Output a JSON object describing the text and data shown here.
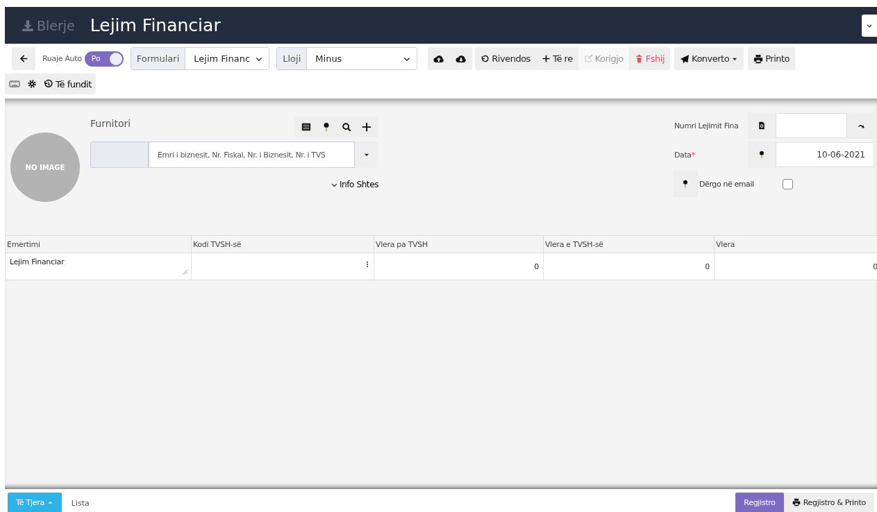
{
  "header": {
    "section": "Blerje",
    "title": "Lejim Financiar"
  },
  "toolbar": {
    "autosave": {
      "label": "Ruaje Auto",
      "on": true,
      "text": "Po"
    },
    "selects": [
      {
        "label": "Formulari",
        "value": "Lejim Financ"
      },
      {
        "label": "Lloji",
        "value": "Minus"
      }
    ],
    "buttons": [
      {
        "kind": "reset",
        "label": "Rivendos",
        "disabled": false
      },
      {
        "kind": "new",
        "label": "Të re",
        "disabled": false
      },
      {
        "kind": "edit",
        "label": "Korigjo",
        "disabled": true
      },
      {
        "kind": "delete",
        "label": "Fshij",
        "disabled": false
      }
    ],
    "convert": {
      "label": "Konverto"
    },
    "print": {
      "label": "Printo"
    },
    "recent": {
      "label": "Të fundit"
    }
  },
  "supplier": {
    "avatar_text": "NO IMAGE",
    "label": "Furnitori",
    "placeholder": "Emri i biznesit, Nr. Fiskal, Nr. i Biznesit, Nr. i TVS",
    "more": "Info Shtes"
  },
  "fields": [
    {
      "label": "Numri Lejimit Fina"
    },
    {
      "label": "Data",
      "required_mark": "*",
      "value": "10-06-2021"
    }
  ],
  "email": {
    "label": "Dërgo në email",
    "checked": false
  },
  "table": {
    "columns": [
      "Emertimi",
      "Kodi TVSH-së",
      "Vlera pa TVSH",
      "Vlera e TVSH-së",
      "Vlera"
    ],
    "rows": [
      [
        "Lejim Financiar",
        "",
        "0",
        "0",
        "0"
      ]
    ]
  },
  "footer": {
    "other": "Të Tjera",
    "list": "Lista",
    "register": "Regjistro",
    "register_print": "Regjistro & Printo"
  }
}
